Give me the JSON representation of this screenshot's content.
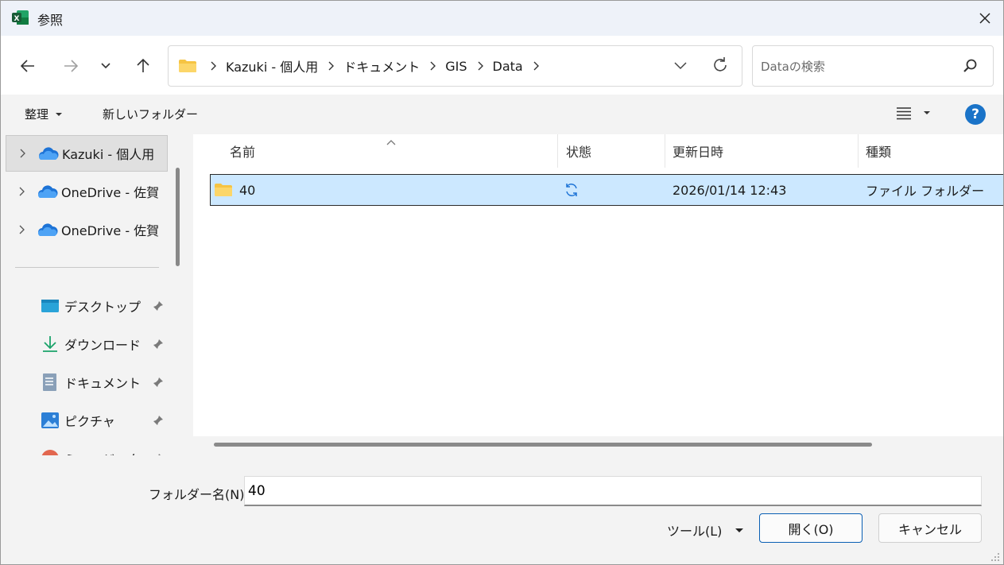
{
  "window": {
    "title": "参照"
  },
  "address": {
    "crumbs": [
      "Kazuki - 個人用",
      "ドキュメント",
      "GIS",
      "Data"
    ]
  },
  "search": {
    "placeholder": "Dataの検索"
  },
  "toolbar": {
    "organize": "整理",
    "new_folder": "新しいフォルダー",
    "help": "?"
  },
  "navpane": {
    "cloud_items": [
      {
        "label": "Kazuki - 個人用",
        "selected": true
      },
      {
        "label": "OneDrive - 佐賀"
      },
      {
        "label": "OneDrive - 佐賀"
      }
    ],
    "quick_access": [
      {
        "label": "デスクトップ",
        "icon": "desktop-icon"
      },
      {
        "label": "ダウンロード",
        "icon": "download-icon"
      },
      {
        "label": "ドキュメント",
        "icon": "document-icon"
      },
      {
        "label": "ピクチャ",
        "icon": "pictures-icon"
      },
      {
        "label": "ミュージック",
        "icon": "music-icon"
      }
    ]
  },
  "columns": {
    "name": "名前",
    "status": "状態",
    "modified": "更新日時",
    "type": "種類"
  },
  "rows": [
    {
      "name": "40",
      "modified": "2026/01/14 12:43",
      "type": "ファイル フォルダー"
    }
  ],
  "bottom": {
    "folder_label": "フォルダー名(N):",
    "folder_value": "40",
    "tools": "ツール(L)",
    "open": "開く(O)",
    "cancel": "キャンセル"
  },
  "colors": {
    "accent": "#1a73c8",
    "selection": "#cce8ff",
    "folder": "#f6c443",
    "cloud": "#1d73d6"
  }
}
